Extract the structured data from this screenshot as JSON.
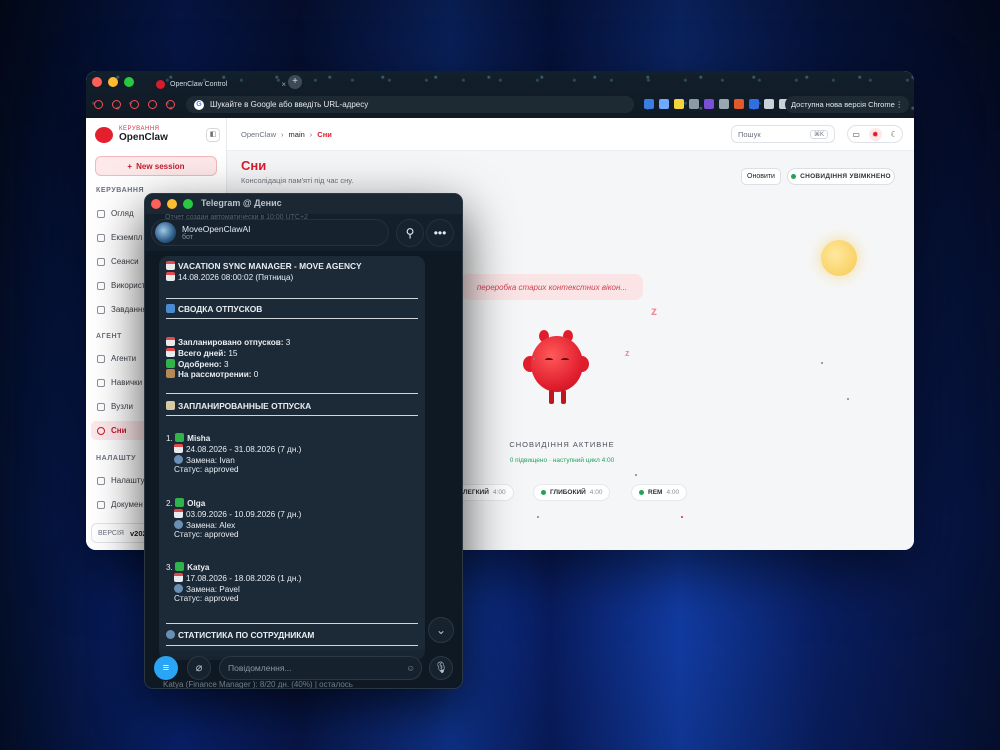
{
  "browser": {
    "tab_title": "OpenClaw Control",
    "tab_close": "×",
    "new_tab": "+",
    "url_placeholder": "Шукайте в Google або введіть URL-адресу",
    "update_label": "Доступна нова версія Chrome",
    "update_menu": "⋮"
  },
  "app": {
    "brand_small": "КЕРУВАННЯ",
    "brand_name": "OpenClaw",
    "collapse_icon": "◧",
    "new_session": "New session",
    "sections": {
      "manage": "КЕРУВАННЯ",
      "agent": "АГЕНТ",
      "settings": "НАЛАШТУ"
    },
    "nav": [
      {
        "label": "Огляд"
      },
      {
        "label": "Екземпл"
      },
      {
        "label": "Сеанси"
      },
      {
        "label": "Використ"
      },
      {
        "label": "Завдання"
      },
      {
        "label": "Агенти"
      },
      {
        "label": "Навички"
      },
      {
        "label": "Вузли"
      },
      {
        "label": "Сни"
      },
      {
        "label": "Налашту"
      },
      {
        "label": "Докумен"
      }
    ],
    "version_label": "ВЕРСІЯ",
    "version_value": "v202"
  },
  "topbar": {
    "crumb_root": "OpenClaw",
    "crumb_mid": "main",
    "crumb_current": "Сни",
    "search_placeholder": "Пошук",
    "search_kbd": "⌘K"
  },
  "dreams": {
    "title": "Сни",
    "subtitle": "Консолідація пам'яті під час сну.",
    "refresh": "Оновити",
    "status_badge": "СНОВИДІННЯ УВІМКНЕНО",
    "bubble": "переробка старих контекстних вікон...",
    "state_label": "СНОВИДІННЯ АКТИВНЕ",
    "meta": "0 підвищено · наступний цикл 4:00",
    "phases": [
      {
        "name": "ЛЕГКИЙ",
        "time": "4:00"
      },
      {
        "name": "ГЛИБОКИЙ",
        "time": "4:00"
      },
      {
        "name": "REM",
        "time": "4:00"
      }
    ]
  },
  "telegram": {
    "window_title": "Telegram @ Денис",
    "chat_name": "MoveOpenClawAI",
    "chat_sub": "бот",
    "behind_1": "Отчет создан автоматически в 10:00 UTC+2",
    "message": {
      "header_title": "VACATION SYNC MANAGER - MOVE AGENCY",
      "header_date": "14.08.2026 08:00:02 (Пятница)",
      "summary_title": "СВОДКА ОТПУСКОВ",
      "planned_label": "Запланировано отпусков:",
      "planned_value": "3",
      "days_label": "Всего дней:",
      "days_value": "15",
      "approved_label": "Одобрено:",
      "approved_value": "3",
      "review_label": "На рассмотрении:",
      "review_value": "0",
      "list_title": "ЗАПЛАНИРОВАННЫЕ ОТПУСКА",
      "vacations": [
        {
          "num": "1.",
          "name": "Misha",
          "dates": "24.08.2026 - 31.08.2026 (7 дн.)",
          "sub": "Замена: Ivan",
          "status": "Статус: approved"
        },
        {
          "num": "2.",
          "name": "Olga",
          "dates": "03.09.2026 - 10.09.2026 (7 дн.)",
          "sub": "Замена: Alex",
          "status": "Статус: approved"
        },
        {
          "num": "3.",
          "name": "Katya",
          "dates": "17.08.2026 - 18.08.2026 (1 дн.)",
          "sub": "Замена: Pavel",
          "status": "Статус: approved"
        }
      ],
      "stats_title": "СТАТИСТИКА ПО СОТРУДНИКАМ"
    },
    "ghost_line": "Katya       (Finance Manager     ): 8/20 дн. (40%) | осталось",
    "input_placeholder": "Повідомлення..."
  },
  "colors": {
    "accent": "#d81c2c",
    "telegram_accent": "#2aa4f4",
    "success": "#22a35a"
  }
}
